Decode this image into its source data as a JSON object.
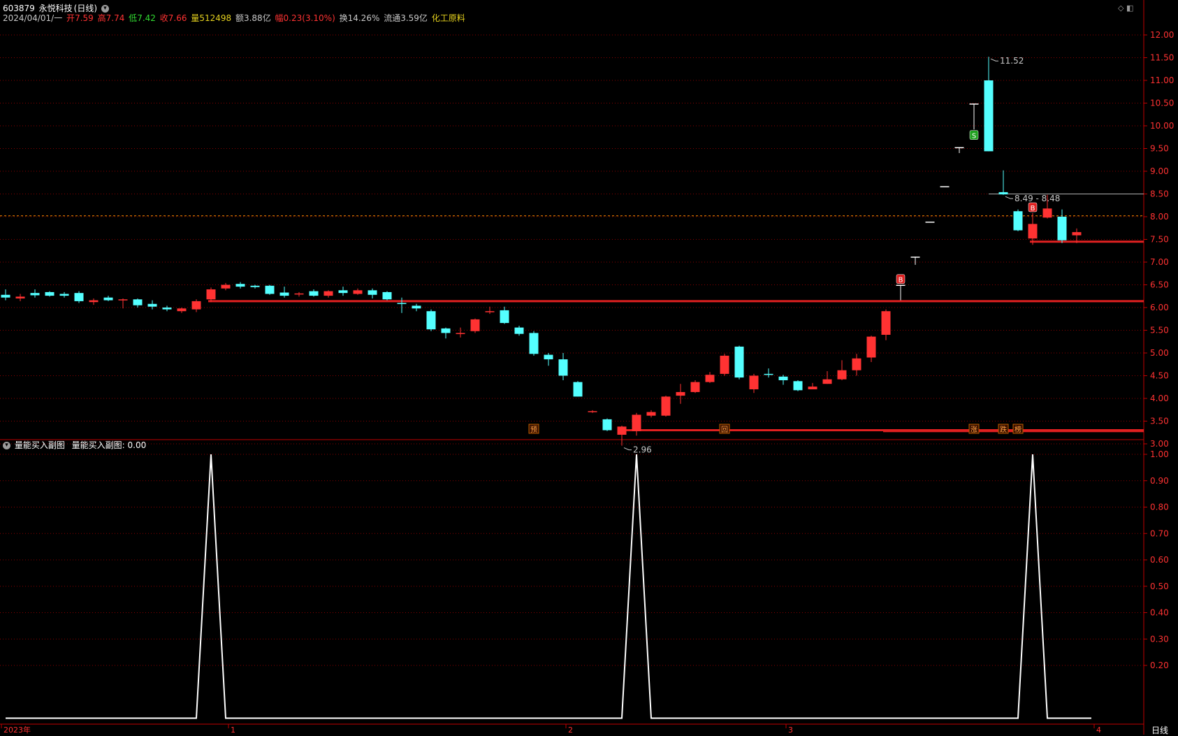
{
  "header": {
    "code": "603879",
    "name": "永悦科技",
    "period": "(日线)",
    "date": "2024/04/01/一",
    "open_label": "开",
    "open": "7.59",
    "high_label": "高",
    "high": "7.74",
    "low_label": "低",
    "low": "7.42",
    "close_label": "收",
    "close": "7.66",
    "vol_label": "量",
    "vol": "512498",
    "amt_label": "额",
    "amt": "3.88亿",
    "chg_label": "幅",
    "chg": "0.23(3.10%)",
    "turnover_label": "换",
    "turnover": "14.26%",
    "float_label": "流通",
    "float": "3.59亿",
    "sector": "化工原料"
  },
  "sub_panel": {
    "indicator": "量能买入副图",
    "value_label": "量能买入副图:",
    "value": "0.00"
  },
  "footer": {
    "period_tab": "日线"
  },
  "colors": {
    "up": "#ff3232",
    "down": "#54ffff",
    "neutral": "#ffffff",
    "grid": "#8b0000",
    "axis": "#c00000",
    "support_line": "#e02020",
    "prev_close": "#ff8c00"
  },
  "chart_data": [
    {
      "type": "candlestick",
      "y_ticks": [
        "12.00",
        "11.50",
        "11.00",
        "10.50",
        "10.00",
        "9.50",
        "9.00",
        "8.50",
        "8.00",
        "7.50",
        "7.00",
        "6.50",
        "6.00",
        "5.50",
        "5.00",
        "4.50",
        "4.00",
        "3.50",
        "3.00"
      ],
      "ylim": [
        2.8,
        12.2
      ],
      "x_ticks": [
        "2023年",
        "1",
        "2",
        "3",
        "4"
      ],
      "x_tick_index": [
        0,
        15,
        38,
        53,
        74
      ],
      "candles": [
        {
          "o": 6.28,
          "c": 6.22,
          "h": 6.4,
          "l": 6.16
        },
        {
          "o": 6.2,
          "c": 6.24,
          "h": 6.3,
          "l": 6.14
        },
        {
          "o": 6.32,
          "c": 6.27,
          "h": 6.4,
          "l": 6.22
        },
        {
          "o": 6.34,
          "c": 6.26,
          "h": 6.36,
          "l": 6.24
        },
        {
          "o": 6.3,
          "c": 6.26,
          "h": 6.34,
          "l": 6.22
        },
        {
          "o": 6.32,
          "c": 6.14,
          "h": 6.36,
          "l": 6.1
        },
        {
          "o": 6.12,
          "c": 6.16,
          "h": 6.2,
          "l": 6.06
        },
        {
          "o": 6.22,
          "c": 6.16,
          "h": 6.26,
          "l": 6.14
        },
        {
          "o": 6.17,
          "c": 6.18,
          "h": 6.2,
          "l": 5.98
        },
        {
          "o": 6.18,
          "c": 6.05,
          "h": 6.2,
          "l": 6.0
        },
        {
          "o": 6.08,
          "c": 6.02,
          "h": 6.16,
          "l": 5.96
        },
        {
          "o": 6.0,
          "c": 5.96,
          "h": 6.04,
          "l": 5.92
        },
        {
          "o": 5.92,
          "c": 5.98,
          "h": 6.0,
          "l": 5.88
        },
        {
          "o": 5.96,
          "c": 6.14,
          "h": 6.18,
          "l": 5.9
        },
        {
          "o": 6.18,
          "c": 6.4,
          "h": 6.44,
          "l": 6.12
        },
        {
          "o": 6.42,
          "c": 6.5,
          "h": 6.54,
          "l": 6.38
        },
        {
          "o": 6.52,
          "c": 6.46,
          "h": 6.56,
          "l": 6.42
        },
        {
          "o": 6.48,
          "c": 6.45,
          "h": 6.5,
          "l": 6.42
        },
        {
          "o": 6.48,
          "c": 6.3,
          "h": 6.5,
          "l": 6.28
        },
        {
          "o": 6.33,
          "c": 6.26,
          "h": 6.46,
          "l": 6.22
        },
        {
          "o": 6.3,
          "c": 6.31,
          "h": 6.34,
          "l": 6.24
        },
        {
          "o": 6.36,
          "c": 6.26,
          "h": 6.4,
          "l": 6.24
        },
        {
          "o": 6.26,
          "c": 6.36,
          "h": 6.38,
          "l": 6.22
        },
        {
          "o": 6.38,
          "c": 6.32,
          "h": 6.46,
          "l": 6.26
        },
        {
          "o": 6.3,
          "c": 6.38,
          "h": 6.42,
          "l": 6.28
        },
        {
          "o": 6.38,
          "c": 6.28,
          "h": 6.42,
          "l": 6.2
        },
        {
          "o": 6.34,
          "c": 6.18,
          "h": 6.36,
          "l": 6.16
        },
        {
          "o": 6.1,
          "c": 6.08,
          "h": 6.22,
          "l": 5.88
        },
        {
          "o": 6.04,
          "c": 5.98,
          "h": 6.08,
          "l": 5.92
        },
        {
          "o": 5.92,
          "c": 5.52,
          "h": 5.96,
          "l": 5.48
        },
        {
          "o": 5.54,
          "c": 5.44,
          "h": 5.56,
          "l": 5.32
        },
        {
          "o": 5.42,
          "c": 5.44,
          "h": 5.56,
          "l": 5.34
        },
        {
          "o": 5.48,
          "c": 5.74,
          "h": 5.76,
          "l": 5.44
        },
        {
          "o": 5.9,
          "c": 5.92,
          "h": 6.02,
          "l": 5.86
        },
        {
          "o": 5.94,
          "c": 5.66,
          "h": 6.02,
          "l": 5.64
        },
        {
          "o": 5.56,
          "c": 5.42,
          "h": 5.6,
          "l": 5.38
        },
        {
          "o": 5.44,
          "c": 4.98,
          "h": 5.48,
          "l": 4.94
        },
        {
          "o": 4.96,
          "c": 4.86,
          "h": 5.0,
          "l": 4.72
        },
        {
          "o": 4.86,
          "c": 4.5,
          "h": 5.0,
          "l": 4.4
        },
        {
          "o": 4.36,
          "c": 4.04,
          "h": 4.38,
          "l": 4.04
        },
        {
          "o": 3.71,
          "c": 3.72,
          "h": 3.74,
          "l": 3.68
        },
        {
          "o": 3.54,
          "c": 3.3,
          "h": 3.56,
          "l": 3.28
        },
        {
          "o": 3.2,
          "c": 3.38,
          "h": 3.4,
          "l": 2.96
        },
        {
          "o": 3.28,
          "c": 3.64,
          "h": 3.68,
          "l": 3.18
        },
        {
          "o": 3.62,
          "c": 3.7,
          "h": 3.74,
          "l": 3.58
        },
        {
          "o": 3.62,
          "c": 4.04,
          "h": 4.06,
          "l": 3.6
        },
        {
          "o": 4.06,
          "c": 4.14,
          "h": 4.32,
          "l": 3.88
        },
        {
          "o": 4.14,
          "c": 4.36,
          "h": 4.4,
          "l": 4.12
        },
        {
          "o": 4.36,
          "c": 4.52,
          "h": 4.58,
          "l": 4.34
        },
        {
          "o": 4.54,
          "c": 4.94,
          "h": 4.98,
          "l": 4.5
        },
        {
          "o": 5.14,
          "c": 4.46,
          "h": 5.16,
          "l": 4.42
        },
        {
          "o": 4.2,
          "c": 4.5,
          "h": 4.54,
          "l": 4.12
        },
        {
          "o": 4.54,
          "c": 4.52,
          "h": 4.66,
          "l": 4.46
        },
        {
          "o": 4.48,
          "c": 4.4,
          "h": 4.52,
          "l": 4.3
        },
        {
          "o": 4.38,
          "c": 4.18,
          "h": 4.4,
          "l": 4.16
        },
        {
          "o": 4.2,
          "c": 4.26,
          "h": 4.34,
          "l": 4.2
        },
        {
          "o": 4.32,
          "c": 4.42,
          "h": 4.6,
          "l": 4.32
        },
        {
          "o": 4.42,
          "c": 4.62,
          "h": 4.84,
          "l": 4.4
        },
        {
          "o": 4.62,
          "c": 4.88,
          "h": 4.98,
          "l": 4.5
        },
        {
          "o": 4.9,
          "c": 5.36,
          "h": 5.38,
          "l": 4.8
        },
        {
          "o": 5.4,
          "c": 5.92,
          "h": 5.96,
          "l": 5.28
        },
        {
          "o": 6.5,
          "c": 6.5,
          "h": 6.5,
          "l": 6.16
        },
        {
          "o": 7.12,
          "c": 7.12,
          "h": 7.12,
          "l": 6.94
        },
        {
          "o": 7.89,
          "c": 7.89,
          "h": 7.89,
          "l": 7.89
        },
        {
          "o": 8.67,
          "c": 8.67,
          "h": 8.67,
          "l": 8.67
        },
        {
          "o": 9.53,
          "c": 9.53,
          "h": 9.53,
          "l": 9.4
        },
        {
          "o": 10.49,
          "c": 10.49,
          "h": 10.49,
          "l": 9.92
        },
        {
          "o": 11.0,
          "c": 9.44,
          "h": 11.52,
          "l": 9.44
        },
        {
          "o": 8.54,
          "c": 8.49,
          "h": 9.02,
          "l": 8.48
        },
        {
          "o": 8.12,
          "c": 7.7,
          "h": 8.16,
          "l": 7.68
        },
        {
          "o": 7.52,
          "c": 7.84,
          "h": 8.08,
          "l": 7.38
        },
        {
          "o": 7.98,
          "c": 8.18,
          "h": 8.48,
          "l": 7.96
        },
        {
          "o": 8.0,
          "c": 7.48,
          "h": 8.16,
          "l": 7.42
        },
        {
          "o": 7.59,
          "c": 7.66,
          "h": 7.74,
          "l": 7.42
        }
      ],
      "support_lines": [
        {
          "from": 14,
          "to": 74,
          "y": 6.14
        },
        {
          "from": 42,
          "to": 60,
          "y": 3.3
        },
        {
          "from": 60,
          "to": 74,
          "y": 3.28
        },
        {
          "from": 70,
          "to": 74,
          "y": 7.45
        }
      ],
      "ref_line": {
        "from": 67,
        "to": 74,
        "y": 8.5
      },
      "prev_close_line": 8.02,
      "annotations": [
        {
          "index": 67,
          "y": 11.52,
          "text": "11.52"
        },
        {
          "index": 42,
          "y": 2.96,
          "text": "2.96"
        },
        {
          "index": 68,
          "y": 8.49,
          "text": "8.49 - 8.48"
        }
      ],
      "signals": [
        {
          "index": 61,
          "text": "B",
          "kind": "buy",
          "y": 6.62
        },
        {
          "index": 70,
          "text": "B",
          "kind": "buy",
          "y": 8.2
        },
        {
          "index": 66,
          "text": "S",
          "kind": "sell",
          "y": 9.79
        }
      ],
      "events": [
        {
          "index": 36,
          "text": "预"
        },
        {
          "index": 49,
          "text": "回"
        },
        {
          "index": 66,
          "text": "涨"
        },
        {
          "index": 68,
          "text": "跌"
        },
        {
          "index": 69,
          "text": "榜"
        }
      ]
    },
    {
      "type": "line",
      "name": "量能买入副图",
      "y_ticks": [
        "1.00",
        "0.90",
        "0.80",
        "0.70",
        "0.60",
        "0.50",
        "0.40",
        "0.30",
        "0.20"
      ],
      "ylim": [
        0,
        1.05
      ],
      "values": [
        0,
        0,
        0,
        0,
        0,
        0,
        0,
        0,
        0,
        0,
        0,
        0,
        0,
        0,
        1,
        0,
        0,
        0,
        0,
        0,
        0,
        0,
        0,
        0,
        0,
        0,
        0,
        0,
        0,
        0,
        0,
        0,
        0,
        0,
        0,
        0,
        0,
        0,
        0,
        0,
        0,
        0,
        0,
        1,
        0,
        0,
        0,
        0,
        0,
        0,
        0,
        0,
        0,
        0,
        0,
        0,
        0,
        0,
        0,
        0,
        0,
        0,
        0,
        0,
        0,
        0,
        0,
        0,
        0,
        0,
        1,
        0,
        0,
        0,
        0
      ]
    }
  ]
}
